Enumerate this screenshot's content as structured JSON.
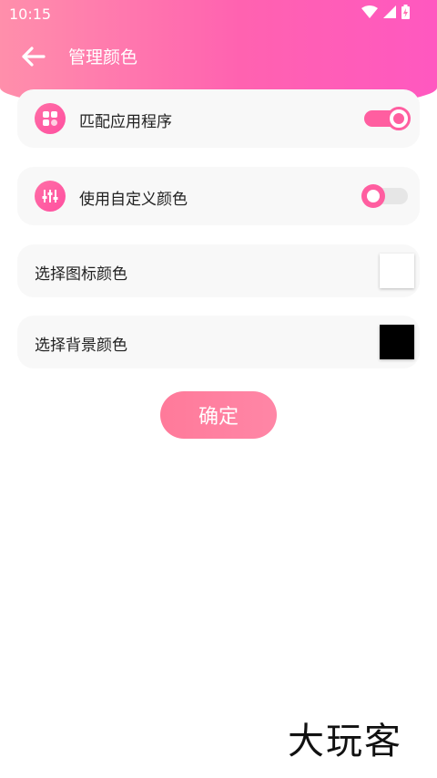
{
  "status_bar": {
    "time": "10:15"
  },
  "title_bar": {
    "title": "管理颜色"
  },
  "settings": {
    "match_app": {
      "label": "匹配应用程序",
      "enabled": true
    },
    "custom_color": {
      "label": "使用自定义颜色",
      "enabled": false
    },
    "icon_color": {
      "label": "选择图标颜色",
      "color": "#ffffff"
    },
    "background_color": {
      "label": "选择背景颜色",
      "color": "#000000"
    }
  },
  "confirm_button": {
    "label": "确定"
  },
  "watermark": {
    "text": "大玩客"
  },
  "colors": {
    "accent": "#ff5ea0",
    "header_start": "#ff8fab",
    "header_end": "#ff58c0"
  }
}
